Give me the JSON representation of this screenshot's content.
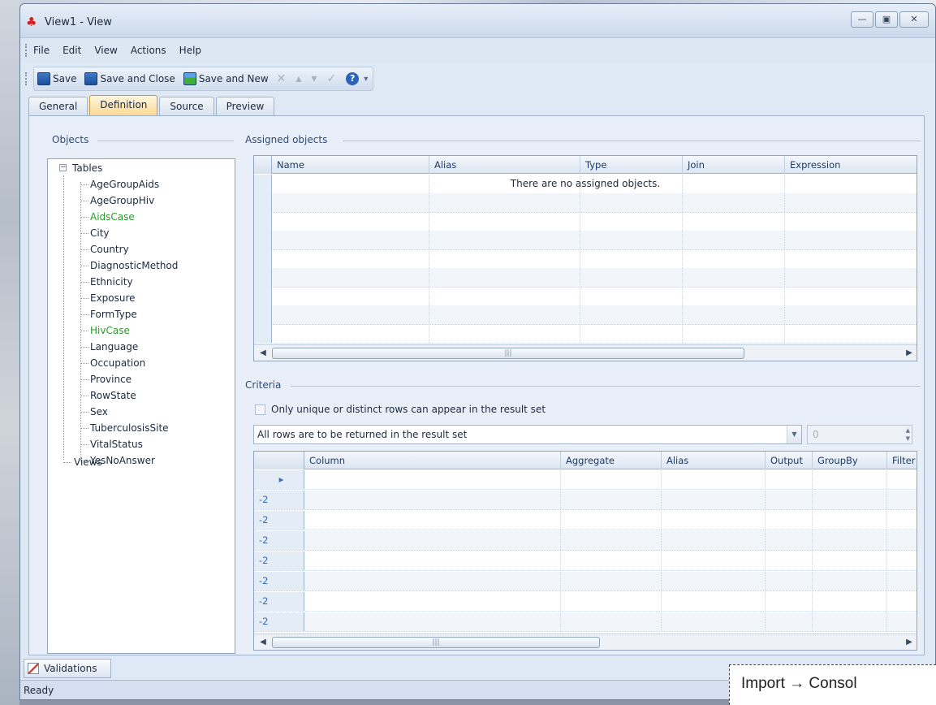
{
  "window": {
    "title": "View1 - View",
    "controls": {
      "minimize": "—",
      "restore": "▣",
      "close": "✕"
    }
  },
  "menu": [
    "File",
    "Edit",
    "View",
    "Actions",
    "Help"
  ],
  "toolbar": {
    "save": "Save",
    "save_close": "Save and Close",
    "save_new": "Save and New",
    "help": "?"
  },
  "tabs": [
    {
      "label": "General",
      "active": false
    },
    {
      "label": "Definition",
      "active": true
    },
    {
      "label": "Source",
      "active": false
    },
    {
      "label": "Preview",
      "active": false
    }
  ],
  "objects": {
    "label": "Objects",
    "root": "Tables",
    "tables": [
      {
        "name": "AgeGroupAids",
        "highlight": false
      },
      {
        "name": "AgeGroupHiv",
        "highlight": false
      },
      {
        "name": "AidsCase",
        "highlight": true
      },
      {
        "name": "City",
        "highlight": false
      },
      {
        "name": "Country",
        "highlight": false
      },
      {
        "name": "DiagnosticMethod",
        "highlight": false
      },
      {
        "name": "Ethnicity",
        "highlight": false
      },
      {
        "name": "Exposure",
        "highlight": false
      },
      {
        "name": "FormType",
        "highlight": false
      },
      {
        "name": "HivCase",
        "highlight": true
      },
      {
        "name": "Language",
        "highlight": false
      },
      {
        "name": "Occupation",
        "highlight": false
      },
      {
        "name": "Province",
        "highlight": false
      },
      {
        "name": "RowState",
        "highlight": false
      },
      {
        "name": "Sex",
        "highlight": false
      },
      {
        "name": "TuberculosisSite",
        "highlight": false
      },
      {
        "name": "VitalStatus",
        "highlight": false
      },
      {
        "name": "YesNoAnswer",
        "highlight": false
      }
    ],
    "views": "Views"
  },
  "assigned": {
    "label": "Assigned objects",
    "columns": [
      "Name",
      "Alias",
      "Type",
      "Join",
      "Expression"
    ],
    "empty_message": "There are no assigned objects."
  },
  "criteria": {
    "label": "Criteria",
    "distinct_label": "Only unique or distinct rows can appear in the result set",
    "rows_option": "All rows are to be returned in the result set",
    "count_value": "0",
    "columns": [
      "Column",
      "Aggregate",
      "Alias",
      "Output",
      "GroupBy",
      "Filter"
    ],
    "row_indicators": [
      "▸",
      "-2",
      "-2",
      "-2",
      "-2",
      "-2",
      "-2",
      "-2"
    ]
  },
  "bottom_tab": "Validations",
  "status": "Ready",
  "overlay_text": "Import → Consol",
  "colors": {
    "highlight_text": "#2c9a2c",
    "active_tab": "#fbd88f"
  }
}
